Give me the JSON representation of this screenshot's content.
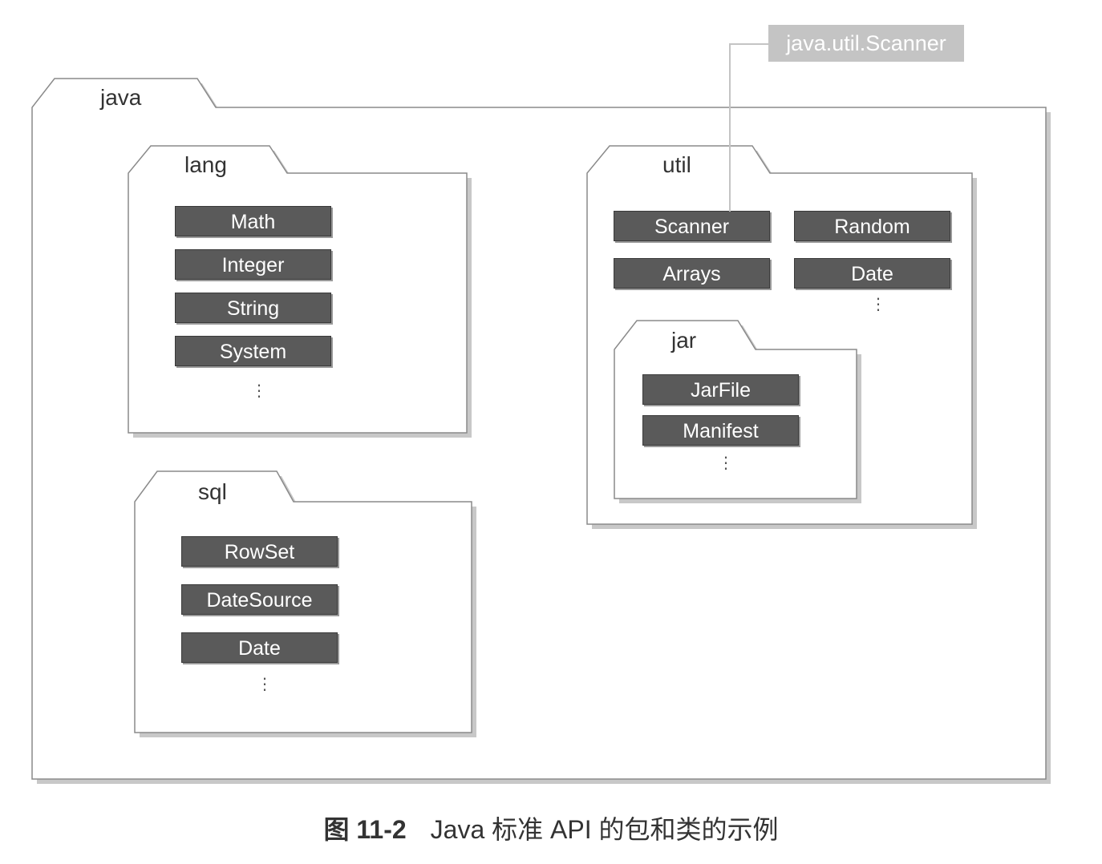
{
  "packages": {
    "java": {
      "label": "java"
    },
    "lang": {
      "label": "lang",
      "classes": [
        "Math",
        "Integer",
        "String",
        "System"
      ],
      "ellipsis": "⋮"
    },
    "sql": {
      "label": "sql",
      "classes": [
        "RowSet",
        "DateSource",
        "Date"
      ],
      "ellipsis": "⋮"
    },
    "util": {
      "label": "util",
      "classes": [
        "Scanner",
        "Random",
        "Arrays",
        "Date"
      ],
      "ellipsis": "⋮"
    },
    "jar": {
      "label": "jar",
      "classes": [
        "JarFile",
        "Manifest"
      ],
      "ellipsis": "⋮"
    }
  },
  "callout": {
    "label": "java.util.Scanner"
  },
  "caption": {
    "figure": "图 11-2",
    "text": "Java 标准 API 的包和类的示例"
  }
}
